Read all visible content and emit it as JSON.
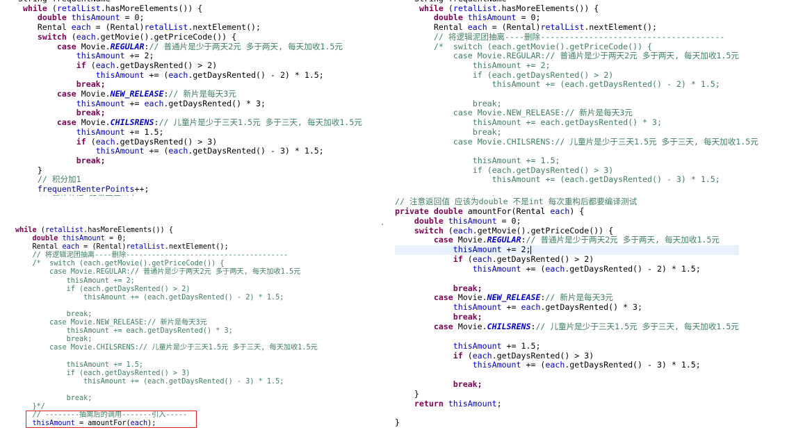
{
  "top_left": {
    "lines": [
      [
        {
          "t": "String frequentName",
          "c": ""
        }
      ],
      [
        {
          "t": " while",
          "c": "kw"
        },
        {
          "t": " (",
          "c": ""
        },
        {
          "t": "retalList",
          "c": "fld"
        },
        {
          "t": ".hasMoreElements()) {",
          "c": ""
        }
      ],
      [
        {
          "t": "    ",
          "c": ""
        },
        {
          "t": "double",
          "c": "kw"
        },
        {
          "t": " ",
          "c": ""
        },
        {
          "t": "thisAmount",
          "c": "fld"
        },
        {
          "t": " = 0;",
          "c": ""
        }
      ],
      [
        {
          "t": "    Rental ",
          "c": ""
        },
        {
          "t": "each",
          "c": "fld"
        },
        {
          "t": " = (Rental)",
          "c": ""
        },
        {
          "t": "retalList",
          "c": "fld"
        },
        {
          "t": ".nextElement();",
          "c": ""
        }
      ],
      [
        {
          "t": "    ",
          "c": ""
        },
        {
          "t": "switch",
          "c": "kw"
        },
        {
          "t": " (",
          "c": ""
        },
        {
          "t": "each",
          "c": "fld"
        },
        {
          "t": ".getMovie().getPriceCode()) {",
          "c": ""
        }
      ],
      [
        {
          "t": "        ",
          "c": ""
        },
        {
          "t": "case",
          "c": "kw"
        },
        {
          "t": " Movie.",
          "c": ""
        },
        {
          "t": "REGULAR",
          "c": "sfld"
        },
        {
          "t": ":",
          "c": ""
        },
        {
          "t": "// 普通片是少于两天2元 多于两天, 每天加收1.5元",
          "c": "cm"
        }
      ],
      [
        {
          "t": "            ",
          "c": ""
        },
        {
          "t": "thisAmount",
          "c": "fld"
        },
        {
          "t": " += 2;",
          "c": ""
        }
      ],
      [
        {
          "t": "            ",
          "c": ""
        },
        {
          "t": "if",
          "c": "kw"
        },
        {
          "t": " (",
          "c": ""
        },
        {
          "t": "each",
          "c": "fld"
        },
        {
          "t": ".getDaysRented() > 2)",
          "c": ""
        }
      ],
      [
        {
          "t": "                ",
          "c": ""
        },
        {
          "t": "thisAmount",
          "c": "fld"
        },
        {
          "t": " += (",
          "c": ""
        },
        {
          "t": "each",
          "c": "fld"
        },
        {
          "t": ".getDaysRented() - 2) * 1.5;",
          "c": ""
        }
      ],
      [
        {
          "t": "            ",
          "c": ""
        },
        {
          "t": "break;",
          "c": "kw"
        }
      ],
      [
        {
          "t": "        ",
          "c": ""
        },
        {
          "t": "case",
          "c": "kw"
        },
        {
          "t": " Movie.",
          "c": ""
        },
        {
          "t": "NEW_RELEASE",
          "c": "sfld"
        },
        {
          "t": ":",
          "c": ""
        },
        {
          "t": "// 新片是每天3元",
          "c": "cm"
        }
      ],
      [
        {
          "t": "            ",
          "c": ""
        },
        {
          "t": "thisAmount",
          "c": "fld"
        },
        {
          "t": " += ",
          "c": ""
        },
        {
          "t": "each",
          "c": "fld"
        },
        {
          "t": ".getDaysRented() * 3;",
          "c": ""
        }
      ],
      [
        {
          "t": "            ",
          "c": ""
        },
        {
          "t": "break;",
          "c": "kw"
        }
      ],
      [
        {
          "t": "        ",
          "c": ""
        },
        {
          "t": "case",
          "c": "kw"
        },
        {
          "t": " Movie.",
          "c": ""
        },
        {
          "t": "CHILSRENS",
          "c": "sfld"
        },
        {
          "t": ":",
          "c": ""
        },
        {
          "t": "// 儿童片是少于三天1.5元 多于三天, 每天加收1.5元",
          "c": "cm"
        }
      ],
      [
        {
          "t": "            ",
          "c": ""
        },
        {
          "t": "thisAmount",
          "c": "fld"
        },
        {
          "t": " += 1.5;",
          "c": ""
        }
      ],
      [
        {
          "t": "            ",
          "c": ""
        },
        {
          "t": "if",
          "c": "kw"
        },
        {
          "t": " (",
          "c": ""
        },
        {
          "t": "each",
          "c": "fld"
        },
        {
          "t": ".getDaysRented() > 3)",
          "c": ""
        }
      ],
      [
        {
          "t": "                ",
          "c": ""
        },
        {
          "t": "thisAmount",
          "c": "fld"
        },
        {
          "t": " += (",
          "c": ""
        },
        {
          "t": "each",
          "c": "fld"
        },
        {
          "t": ".getDaysRented() - 3) * 1.5;",
          "c": ""
        }
      ],
      [
        {
          "t": "            ",
          "c": ""
        },
        {
          "t": "break;",
          "c": "kw"
        }
      ],
      [
        {
          "t": "    }",
          "c": ""
        }
      ],
      [
        {
          "t": "    ",
          "c": ""
        },
        {
          "t": "// 积分加1",
          "c": "cm"
        }
      ],
      [
        {
          "t": "    ",
          "c": ""
        },
        {
          "t": "frequentRenterPoints",
          "c": "fld"
        },
        {
          "t": "++;",
          "c": ""
        }
      ],
      [
        {
          "t": "    ",
          "c": ""
        },
        {
          "t": "// 新片的话 租借两天以上",
          "c": "cm"
        }
      ]
    ]
  },
  "top_right": {
    "lines": [
      [
        {
          "t": "String frequentName",
          "c": ""
        }
      ],
      [
        {
          "t": " while",
          "c": "kw"
        },
        {
          "t": " (",
          "c": ""
        },
        {
          "t": "retalList",
          "c": "fld"
        },
        {
          "t": ".hasMoreElements()) {",
          "c": ""
        }
      ],
      [
        {
          "t": "    ",
          "c": ""
        },
        {
          "t": "double",
          "c": "kw"
        },
        {
          "t": " ",
          "c": ""
        },
        {
          "t": "thisAmount",
          "c": "fld"
        },
        {
          "t": " = 0;",
          "c": ""
        }
      ],
      [
        {
          "t": "    Rental ",
          "c": ""
        },
        {
          "t": "each",
          "c": "fld"
        },
        {
          "t": " = (Rental)",
          "c": ""
        },
        {
          "t": "retalList",
          "c": "fld"
        },
        {
          "t": ".nextElement();",
          "c": ""
        }
      ],
      [
        {
          "t": "    // 将逻辑泥团抽离----删除--------------------------------------",
          "c": "cm"
        }
      ],
      [
        {
          "t": "    /*  switch (each.getMovie().getPriceCode()) {",
          "c": "cm"
        }
      ],
      [
        {
          "t": "        case Movie.REGULAR:// 普通片是少于两天2元 多于两天, 每天加收1.5元",
          "c": "cm"
        }
      ],
      [
        {
          "t": "            thisAmount += 2;",
          "c": "cm"
        }
      ],
      [
        {
          "t": "            if (each.getDaysRented() > 2)",
          "c": "cm"
        }
      ],
      [
        {
          "t": "                thisAmount += (each.getDaysRented() - 2) * 1.5;",
          "c": "cm"
        }
      ],
      [
        {
          "t": "",
          "c": ""
        }
      ],
      [
        {
          "t": "            break;",
          "c": "cm"
        }
      ],
      [
        {
          "t": "        case Movie.NEW_RELEASE:// 新片是每天3元",
          "c": "cm"
        }
      ],
      [
        {
          "t": "            thisAmount += each.getDaysRented() * 3;",
          "c": "cm"
        }
      ],
      [
        {
          "t": "            break;",
          "c": "cm"
        }
      ],
      [
        {
          "t": "        case Movie.CHILSRENS:// 儿童片是少于三天1.5元 多于三天, 每天加收1.5元",
          "c": "cm"
        }
      ],
      [
        {
          "t": "",
          "c": ""
        }
      ],
      [
        {
          "t": "            thisAmount += 1.5;",
          "c": "cm"
        }
      ],
      [
        {
          "t": "            if (each.getDaysRented() > 3)",
          "c": "cm"
        }
      ],
      [
        {
          "t": "                thisAmount += (each.getDaysRented() - 3) * 1.5;",
          "c": "cm"
        }
      ],
      [
        {
          "t": "",
          "c": ""
        }
      ],
      [
        {
          "t": "            break;",
          "c": "cm"
        }
      ]
    ]
  },
  "bottom_left": {
    "lines": [
      [
        {
          "t": "while",
          "c": "kw"
        },
        {
          "t": " (",
          "c": ""
        },
        {
          "t": "retalList",
          "c": "fld"
        },
        {
          "t": ".hasMoreElements()) {",
          "c": ""
        }
      ],
      [
        {
          "t": "    ",
          "c": ""
        },
        {
          "t": "double",
          "c": "kw"
        },
        {
          "t": " ",
          "c": ""
        },
        {
          "t": "thisAmount",
          "c": "fld"
        },
        {
          "t": " = 0;",
          "c": ""
        }
      ],
      [
        {
          "t": "    Rental ",
          "c": ""
        },
        {
          "t": "each",
          "c": "fld"
        },
        {
          "t": " = (Rental)",
          "c": ""
        },
        {
          "t": "retalList",
          "c": "fld"
        },
        {
          "t": ".nextElement();",
          "c": ""
        }
      ],
      [
        {
          "t": "    // 将逻辑泥团抽离----删除--------------------------------------",
          "c": "cm"
        }
      ],
      [
        {
          "t": "    /*  switch (each.getMovie().getPriceCode()) {",
          "c": "cm"
        }
      ],
      [
        {
          "t": "        case Movie.REGULAR:// 普通片是少于两天2元 多于两天, 每天加收1.5元",
          "c": "cm"
        }
      ],
      [
        {
          "t": "            thisAmount += 2;",
          "c": "cm"
        }
      ],
      [
        {
          "t": "            if (each.getDaysRented() > 2)",
          "c": "cm"
        }
      ],
      [
        {
          "t": "                thisAmount += (each.getDaysRented() - 2) * 1.5;",
          "c": "cm"
        }
      ],
      [
        {
          "t": "",
          "c": ""
        }
      ],
      [
        {
          "t": "            break;",
          "c": "cm"
        }
      ],
      [
        {
          "t": "        case Movie.NEW_RELEASE:// 新片是每天3元",
          "c": "cm"
        }
      ],
      [
        {
          "t": "            thisAmount += each.getDaysRented() * 3;",
          "c": "cm"
        }
      ],
      [
        {
          "t": "            break;",
          "c": "cm"
        }
      ],
      [
        {
          "t": "        case Movie.CHILSRENS:// 儿童片是少于三天1.5元 多于三天, 每天加收1.5元",
          "c": "cm"
        }
      ],
      [
        {
          "t": "",
          "c": ""
        }
      ],
      [
        {
          "t": "            thisAmount += 1.5;",
          "c": "cm"
        }
      ],
      [
        {
          "t": "            if (each.getDaysRented() > 3)",
          "c": "cm"
        }
      ],
      [
        {
          "t": "                thisAmount += (each.getDaysRented() - 3) * 1.5;",
          "c": "cm"
        }
      ],
      [
        {
          "t": "",
          "c": ""
        }
      ],
      [
        {
          "t": "            break;",
          "c": "cm"
        }
      ],
      [
        {
          "t": "    }*/",
          "c": "cm"
        }
      ],
      [
        {
          "t": "    // --------抽离后的调用-------引入-----",
          "c": "cm"
        }
      ],
      [
        {
          "t": "    ",
          "c": ""
        },
        {
          "t": "thisAmount",
          "c": "fld"
        },
        {
          "t": " = amountFor(",
          "c": ""
        },
        {
          "t": "each",
          "c": "fld"
        },
        {
          "t": ");",
          "c": ""
        }
      ]
    ]
  },
  "bottom_right": {
    "lines": [
      [
        {
          "t": "// 注意返回值 应该为double 不是int 每次重构后都要编译测试",
          "c": "cm"
        }
      ],
      [
        {
          "t": "private",
          "c": "kw"
        },
        {
          "t": " ",
          "c": ""
        },
        {
          "t": "double",
          "c": "kw"
        },
        {
          "t": " amountFor(Rental ",
          "c": ""
        },
        {
          "t": "each",
          "c": "fld"
        },
        {
          "t": ") {",
          "c": ""
        }
      ],
      [
        {
          "t": "    ",
          "c": ""
        },
        {
          "t": "double",
          "c": "kw"
        },
        {
          "t": " ",
          "c": ""
        },
        {
          "t": "thisAmount",
          "c": "fld"
        },
        {
          "t": " = 0;",
          "c": ""
        }
      ],
      [
        {
          "t": "    ",
          "c": ""
        },
        {
          "t": "switch",
          "c": "kw"
        },
        {
          "t": " (",
          "c": ""
        },
        {
          "t": "each",
          "c": "fld"
        },
        {
          "t": ".getMovie().getPriceCode()) {",
          "c": ""
        }
      ],
      [
        {
          "t": "        ",
          "c": ""
        },
        {
          "t": "case",
          "c": "kw"
        },
        {
          "t": " Movie.",
          "c": ""
        },
        {
          "t": "REGULAR",
          "c": "sfld"
        },
        {
          "t": ":",
          "c": ""
        },
        {
          "t": "// 普通片是少于两天2元 多于两天, 每天加收1.5元",
          "c": "cm"
        }
      ],
      [
        {
          "t": "            ",
          "c": ""
        },
        {
          "t": "thisAmount",
          "c": "fld"
        },
        {
          "t": " += 2;",
          "c": ""
        },
        {
          "t": "|",
          "c": "caret"
        }
      ],
      [
        {
          "t": "            ",
          "c": ""
        },
        {
          "t": "if",
          "c": "kw"
        },
        {
          "t": " (",
          "c": ""
        },
        {
          "t": "each",
          "c": "fld"
        },
        {
          "t": ".getDaysRented() > 2)",
          "c": ""
        }
      ],
      [
        {
          "t": "                ",
          "c": ""
        },
        {
          "t": "thisAmount",
          "c": "fld"
        },
        {
          "t": " += (",
          "c": ""
        },
        {
          "t": "each",
          "c": "fld"
        },
        {
          "t": ".getDaysRented() - 2) * 1.5;",
          "c": ""
        }
      ],
      [
        {
          "t": "",
          "c": ""
        }
      ],
      [
        {
          "t": "            ",
          "c": ""
        },
        {
          "t": "break;",
          "c": "kw"
        }
      ],
      [
        {
          "t": "        ",
          "c": ""
        },
        {
          "t": "case",
          "c": "kw"
        },
        {
          "t": " Movie.",
          "c": ""
        },
        {
          "t": "NEW_RELEASE",
          "c": "sfld"
        },
        {
          "t": ":",
          "c": ""
        },
        {
          "t": "// 新片是每天3元",
          "c": "cm"
        }
      ],
      [
        {
          "t": "            ",
          "c": ""
        },
        {
          "t": "thisAmount",
          "c": "fld"
        },
        {
          "t": " += ",
          "c": ""
        },
        {
          "t": "each",
          "c": "fld"
        },
        {
          "t": ".getDaysRented() * 3;",
          "c": ""
        }
      ],
      [
        {
          "t": "            ",
          "c": ""
        },
        {
          "t": "break;",
          "c": "kw"
        }
      ],
      [
        {
          "t": "        ",
          "c": ""
        },
        {
          "t": "case",
          "c": "kw"
        },
        {
          "t": " Movie.",
          "c": ""
        },
        {
          "t": "CHILSRENS",
          "c": "sfld"
        },
        {
          "t": ":",
          "c": ""
        },
        {
          "t": "// 儿童片是少于三天1.5元 多于三天, 每天加收1.5元",
          "c": "cm"
        }
      ],
      [
        {
          "t": "",
          "c": ""
        }
      ],
      [
        {
          "t": "            ",
          "c": ""
        },
        {
          "t": "thisAmount",
          "c": "fld"
        },
        {
          "t": " += 1.5;",
          "c": ""
        }
      ],
      [
        {
          "t": "            ",
          "c": ""
        },
        {
          "t": "if",
          "c": "kw"
        },
        {
          "t": " (",
          "c": ""
        },
        {
          "t": "each",
          "c": "fld"
        },
        {
          "t": ".getDaysRented() > 3)",
          "c": ""
        }
      ],
      [
        {
          "t": "                ",
          "c": ""
        },
        {
          "t": "thisAmount",
          "c": "fld"
        },
        {
          "t": " += (",
          "c": ""
        },
        {
          "t": "each",
          "c": "fld"
        },
        {
          "t": ".getDaysRented() - 3) * 1.5;",
          "c": ""
        }
      ],
      [
        {
          "t": "",
          "c": ""
        }
      ],
      [
        {
          "t": "            ",
          "c": ""
        },
        {
          "t": "break;",
          "c": "kw"
        }
      ],
      [
        {
          "t": "    }",
          "c": ""
        }
      ],
      [
        {
          "t": "    ",
          "c": ""
        },
        {
          "t": "return",
          "c": "kw"
        },
        {
          "t": " ",
          "c": ""
        },
        {
          "t": "thisAmount",
          "c": "fld"
        },
        {
          "t": ";",
          "c": ""
        }
      ],
      [
        {
          "t": "",
          "c": ""
        }
      ],
      [
        {
          "t": "}",
          "c": ""
        }
      ]
    ],
    "highlighted_line_index": 5
  },
  "colors": {
    "keyword": "#7f0055",
    "field": "#0000c0",
    "comment": "#3f7f5f",
    "highlight_box": "#e02020",
    "current_line": "#e8f2fe"
  }
}
